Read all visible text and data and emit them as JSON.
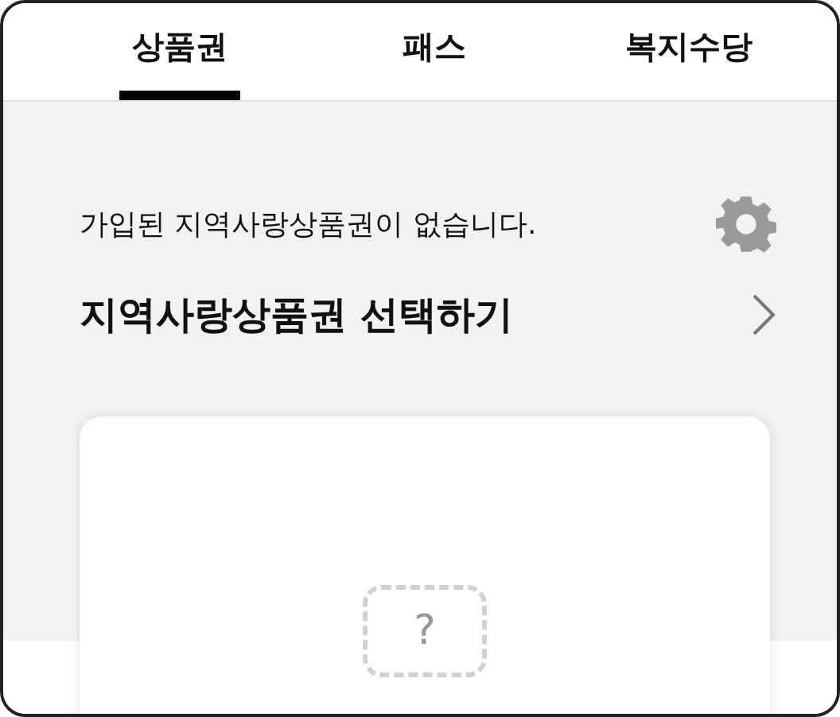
{
  "tabs": [
    {
      "label": "상품권",
      "selected": true
    },
    {
      "label": "패스",
      "selected": false
    },
    {
      "label": "복지수당",
      "selected": false
    }
  ],
  "notice": "가입된 지역사랑상품권이 없습니다.",
  "select_link": "지역사랑상품권 선택하기",
  "card": {
    "image_mark": "?"
  }
}
